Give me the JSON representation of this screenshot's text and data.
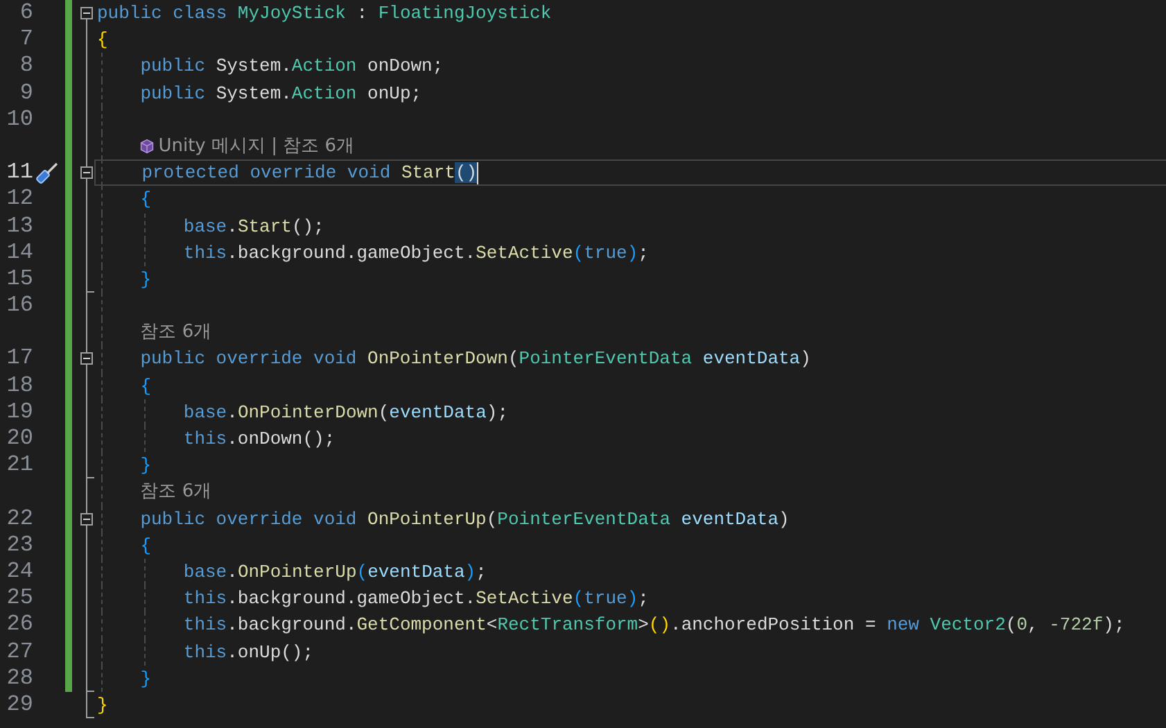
{
  "editor": {
    "lines": [
      {
        "kind": "code",
        "number": "6",
        "changed": true,
        "expanded": true,
        "tokens": [
          {
            "kind": "keyword",
            "text": "public class "
          },
          {
            "kind": "type",
            "text": "MyJoyStick"
          },
          {
            "kind": "plain",
            "text": " : "
          },
          {
            "kind": "type",
            "text": "FloatingJoystick"
          }
        ]
      },
      {
        "kind": "code",
        "number": "7",
        "changed": true,
        "tokens": [
          {
            "kind": "bracket1",
            "text": "{"
          }
        ]
      },
      {
        "kind": "code",
        "number": "8",
        "changed": true,
        "tokens": [
          {
            "kind": "keyword",
            "text": "    public "
          },
          {
            "kind": "plain",
            "text": "System."
          },
          {
            "kind": "type",
            "text": "Action"
          },
          {
            "kind": "plain",
            "text": " onDown;"
          }
        ]
      },
      {
        "kind": "code",
        "number": "9",
        "changed": true,
        "tokens": [
          {
            "kind": "keyword",
            "text": "    public "
          },
          {
            "kind": "plain",
            "text": "System."
          },
          {
            "kind": "type",
            "text": "Action"
          },
          {
            "kind": "plain",
            "text": " onUp;"
          }
        ]
      },
      {
        "kind": "code",
        "number": "10",
        "changed": true
      },
      {
        "kind": "lens",
        "changed": true,
        "icon": true,
        "text": "Unity 메시지 | 참조 6개"
      },
      {
        "kind": "code",
        "number": "11",
        "changed": true,
        "expanded": true,
        "current": true,
        "tokens": [
          {
            "kind": "keyword",
            "text": "    protected override void "
          },
          {
            "kind": "method",
            "text": "Start"
          },
          {
            "kind": "matched",
            "text": "()"
          }
        ]
      },
      {
        "kind": "code",
        "number": "12",
        "changed": true,
        "tokens": [
          {
            "kind": "bracket2",
            "text": "    {"
          }
        ]
      },
      {
        "kind": "code",
        "number": "13",
        "changed": true,
        "tokens": [
          {
            "kind": "keyword",
            "text": "        base"
          },
          {
            "kind": "plain",
            "text": "."
          },
          {
            "kind": "method",
            "text": "Start"
          },
          {
            "kind": "plain",
            "text": "();"
          }
        ]
      },
      {
        "kind": "code",
        "number": "14",
        "changed": true,
        "tokens": [
          {
            "kind": "keyword",
            "text": "        this"
          },
          {
            "kind": "plain",
            "text": ".background.gameObject."
          },
          {
            "kind": "method",
            "text": "SetActive"
          },
          {
            "kind": "bracket2",
            "text": "("
          },
          {
            "kind": "keyword",
            "text": "true"
          },
          {
            "kind": "bracket2",
            "text": ")"
          },
          {
            "kind": "plain",
            "text": ";"
          }
        ]
      },
      {
        "kind": "code",
        "number": "15",
        "changed": true,
        "tokens": [
          {
            "kind": "bracket2",
            "text": "    }"
          }
        ]
      },
      {
        "kind": "code",
        "number": "16",
        "changed": true
      },
      {
        "kind": "lens",
        "changed": true,
        "icon": false,
        "text": "참조 6개"
      },
      {
        "kind": "code",
        "number": "17",
        "changed": true,
        "expanded": true,
        "tokens": [
          {
            "kind": "keyword",
            "text": "    public override void "
          },
          {
            "kind": "method",
            "text": "OnPointerDown"
          },
          {
            "kind": "plain",
            "text": "("
          },
          {
            "kind": "type",
            "text": "PointerEventData"
          },
          {
            "kind": "param",
            "text": " eventData"
          },
          {
            "kind": "plain",
            "text": ")"
          }
        ]
      },
      {
        "kind": "code",
        "number": "18",
        "changed": true,
        "tokens": [
          {
            "kind": "bracket2",
            "text": "    {"
          }
        ]
      },
      {
        "kind": "code",
        "number": "19",
        "changed": true,
        "tokens": [
          {
            "kind": "keyword",
            "text": "        base"
          },
          {
            "kind": "plain",
            "text": "."
          },
          {
            "kind": "method",
            "text": "OnPointerDown"
          },
          {
            "kind": "plain",
            "text": "("
          },
          {
            "kind": "param",
            "text": "eventData"
          },
          {
            "kind": "plain",
            "text": ");"
          }
        ]
      },
      {
        "kind": "code",
        "number": "20",
        "changed": true,
        "tokens": [
          {
            "kind": "keyword",
            "text": "        this"
          },
          {
            "kind": "plain",
            "text": ".onDown();"
          }
        ]
      },
      {
        "kind": "code",
        "number": "21",
        "changed": true,
        "tokens": [
          {
            "kind": "bracket2",
            "text": "    }"
          }
        ]
      },
      {
        "kind": "lens",
        "changed": true,
        "icon": false,
        "text": "참조 6개"
      },
      {
        "kind": "code",
        "number": "22",
        "changed": true,
        "expanded": true,
        "tokens": [
          {
            "kind": "keyword",
            "text": "    public override void "
          },
          {
            "kind": "method",
            "text": "OnPointerUp"
          },
          {
            "kind": "plain",
            "text": "("
          },
          {
            "kind": "type",
            "text": "PointerEventData"
          },
          {
            "kind": "param",
            "text": " eventData"
          },
          {
            "kind": "plain",
            "text": ")"
          }
        ]
      },
      {
        "kind": "code",
        "number": "23",
        "changed": true,
        "tokens": [
          {
            "kind": "bracket2",
            "text": "    {"
          }
        ]
      },
      {
        "kind": "code",
        "number": "24",
        "changed": true,
        "tokens": [
          {
            "kind": "keyword",
            "text": "        base"
          },
          {
            "kind": "plain",
            "text": "."
          },
          {
            "kind": "method",
            "text": "OnPointerUp"
          },
          {
            "kind": "bracket2",
            "text": "("
          },
          {
            "kind": "param",
            "text": "eventData"
          },
          {
            "kind": "bracket2",
            "text": ")"
          },
          {
            "kind": "plain",
            "text": ";"
          }
        ]
      },
      {
        "kind": "code",
        "number": "25",
        "changed": true,
        "tokens": [
          {
            "kind": "keyword",
            "text": "        this"
          },
          {
            "kind": "plain",
            "text": ".background.gameObject."
          },
          {
            "kind": "method",
            "text": "SetActive"
          },
          {
            "kind": "bracket2",
            "text": "("
          },
          {
            "kind": "keyword",
            "text": "true"
          },
          {
            "kind": "bracket2",
            "text": ")"
          },
          {
            "kind": "plain",
            "text": ";"
          }
        ]
      },
      {
        "kind": "code",
        "number": "26",
        "changed": true,
        "tokens": [
          {
            "kind": "keyword",
            "text": "        this"
          },
          {
            "kind": "plain",
            "text": ".background."
          },
          {
            "kind": "method",
            "text": "GetComponent"
          },
          {
            "kind": "plain",
            "text": "<"
          },
          {
            "kind": "type",
            "text": "RectTransform"
          },
          {
            "kind": "plain",
            "text": ">"
          },
          {
            "kind": "bracket1",
            "text": "()"
          },
          {
            "kind": "plain",
            "text": ".anchoredPosition = "
          },
          {
            "kind": "keyword",
            "text": "new "
          },
          {
            "kind": "type",
            "text": "Vector2"
          },
          {
            "kind": "plain",
            "text": "("
          },
          {
            "kind": "number",
            "text": "0"
          },
          {
            "kind": "plain",
            "text": ", "
          },
          {
            "kind": "number",
            "text": "-722f"
          },
          {
            "kind": "plain",
            "text": ");"
          }
        ]
      },
      {
        "kind": "code",
        "number": "27",
        "changed": true,
        "tokens": [
          {
            "kind": "keyword",
            "text": "        this"
          },
          {
            "kind": "plain",
            "text": ".onUp();"
          }
        ]
      },
      {
        "kind": "code",
        "number": "28",
        "changed": true,
        "tokens": [
          {
            "kind": "bracket2",
            "text": "    }"
          }
        ]
      },
      {
        "kind": "code",
        "number": "29",
        "changed": false,
        "tokens": [
          {
            "kind": "bracket1",
            "text": "}"
          }
        ]
      }
    ]
  }
}
